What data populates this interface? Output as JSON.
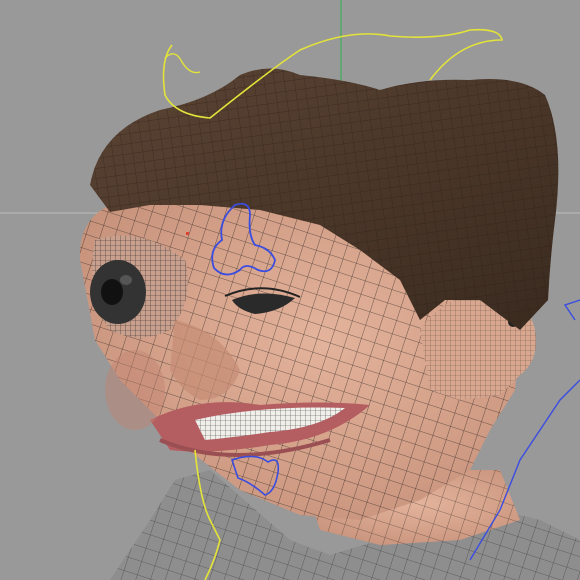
{
  "viewport": {
    "background": "#999999",
    "axis_color_horizontal": "#bdbdbd",
    "axis_color_vertical": "#3fae5a"
  },
  "model": {
    "skin_color": "#d9a78f",
    "skin_shadow": "#b9846e",
    "hair_color": "#4a3628",
    "hair_highlight": "#6e5644",
    "wire_color": "#1a1a1a",
    "teeth_color": "#f1efea",
    "shirt_color": "#8e8e8e",
    "eye_color": "#2a2a2a"
  },
  "rig": {
    "yellow_curve_color": "#e3e33a",
    "blue_control_color": "#3b4de0"
  }
}
